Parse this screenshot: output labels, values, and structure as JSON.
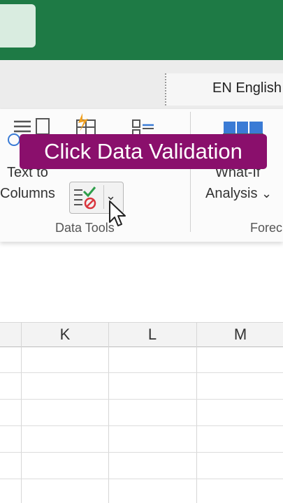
{
  "language": {
    "label": "EN English"
  },
  "ribbon": {
    "text_to_columns": {
      "line1": "Text to",
      "line2": "Columns"
    },
    "what_if": {
      "line1": "What-If",
      "line2": "Analysis",
      "chevron": "⌄"
    },
    "group_data_tools": "Data Tools",
    "group_forecast": "Forec",
    "data_validation": {
      "chevron": "⌄"
    }
  },
  "caption": {
    "text": "Click Data Validation"
  },
  "sheet": {
    "columns": [
      "K",
      "L",
      "M"
    ]
  },
  "colors": {
    "excel_green": "#1e7a45",
    "caption_bg": "#8a0f6c",
    "check_green": "#2e9e4a",
    "prohibit_red": "#d9363e"
  }
}
